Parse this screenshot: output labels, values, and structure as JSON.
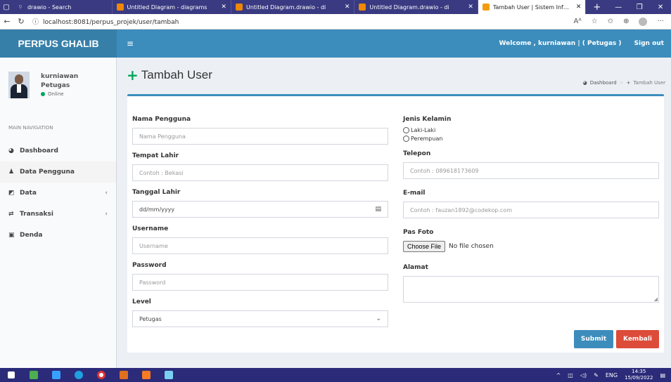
{
  "browser": {
    "tabs": [
      {
        "title": "drawio - Search",
        "icon": "search-icon"
      },
      {
        "title": "Untitled Diagram - diagrams",
        "icon": "drawio-icon"
      },
      {
        "title": "Untitled Diagram.drawio - di",
        "icon": "drawio-icon"
      },
      {
        "title": "Untitled Diagram.drawio - di",
        "icon": "drawio-icon"
      },
      {
        "title": "Tambah User | Sistem Inform",
        "icon": "app-icon"
      }
    ],
    "url": "localhost:8081/perpus_projek/user/tambah"
  },
  "header": {
    "logo": "PERPUS GHALIB",
    "welcome": "Welcome ,  kurniawan | ( Petugas )",
    "signout": "Sign out"
  },
  "sidebar": {
    "user_name": "kurniawan",
    "user_role": "Petugas",
    "status": "Online",
    "nav_header": "MAIN NAVIGATION",
    "items": [
      {
        "label": "Dashboard",
        "icon": "dashboard-icon"
      },
      {
        "label": "Data Pengguna",
        "icon": "user-icon"
      },
      {
        "label": "Data",
        "icon": "edit-icon"
      },
      {
        "label": "Transaksi",
        "icon": "exchange-icon"
      },
      {
        "label": "Denda",
        "icon": "money-icon"
      }
    ]
  },
  "page": {
    "title": "Tambah User",
    "breadcrumb": [
      "Dashboard",
      "Tambah User"
    ]
  },
  "form": {
    "nama_label": "Nama Pengguna",
    "nama_placeholder": "Nama Pengguna",
    "tempat_label": "Tempat Lahir",
    "tempat_placeholder": "Contoh : Bekasi",
    "tanggal_label": "Tanggal Lahir",
    "tanggal_placeholder": "dd/mm/yyyy",
    "username_label": "Username",
    "username_placeholder": "Username",
    "password_label": "Password",
    "password_placeholder": "Password",
    "level_label": "Level",
    "level_value": "Petugas",
    "jk_label": "Jenis Kelamin",
    "jk_options": [
      "Laki-Laki",
      "Perempuan"
    ],
    "telepon_label": "Telepon",
    "telepon_placeholder": "Contoh : 089618173609",
    "email_label": "E-mail",
    "email_placeholder": "Contoh : fauzan1892@codekop.com",
    "foto_label": "Pas Foto",
    "file_button": "Choose File",
    "file_status": "No file chosen",
    "alamat_label": "Alamat",
    "submit": "Submit",
    "kembali": "Kembali"
  },
  "taskbar": {
    "lang": "ENG",
    "time": "14:35",
    "date": "15/09/2022"
  }
}
